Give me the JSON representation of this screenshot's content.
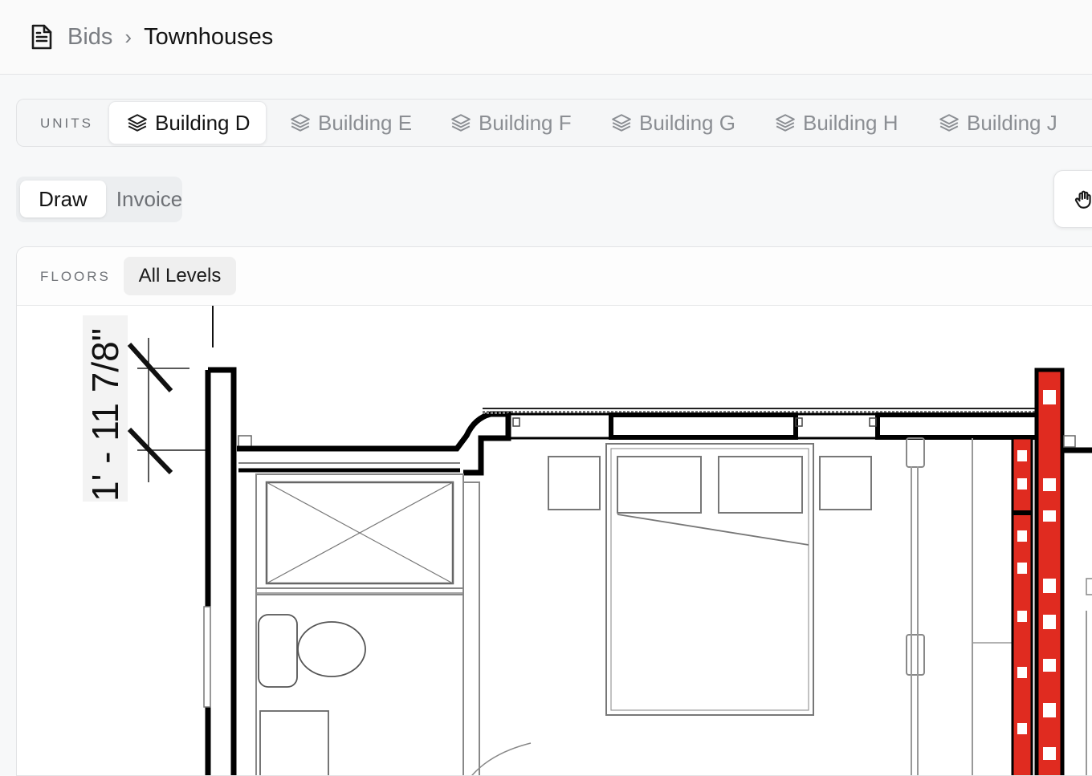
{
  "breadcrumb": {
    "root": "Bids",
    "separator": "›",
    "current": "Townhouses",
    "icon": "document-icon"
  },
  "units": {
    "label": "UNITS",
    "icon": "layers-icon",
    "tabs": [
      {
        "label": "Building D",
        "active": true
      },
      {
        "label": "Building E",
        "active": false
      },
      {
        "label": "Building F",
        "active": false
      },
      {
        "label": "Building G",
        "active": false
      },
      {
        "label": "Building H",
        "active": false
      },
      {
        "label": "Building J",
        "active": false
      }
    ]
  },
  "mode": {
    "options": [
      "Draw",
      "Invoice"
    ],
    "selected": "Draw"
  },
  "tools": {
    "pan_icon": "hand-icon"
  },
  "floors": {
    "label": "FLOORS",
    "selected": "All Levels"
  },
  "plan": {
    "dimension_text": "1' - 11 7/8\""
  },
  "colors": {
    "accent_red": "#e02b20",
    "background": "#f7f8f9"
  }
}
